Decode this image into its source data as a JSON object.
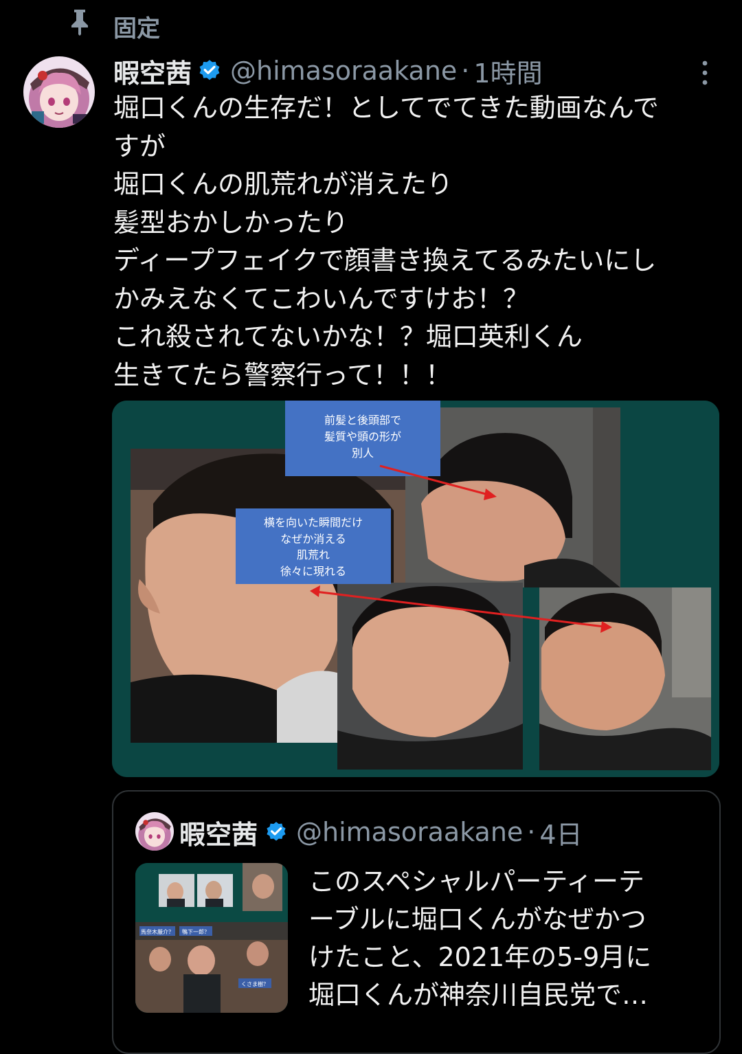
{
  "pinned": {
    "label": "固定",
    "icon": "pin-icon"
  },
  "post": {
    "author_name": "暇空茜",
    "handle": "@himasoraakane",
    "separator": "·",
    "time": "1時間",
    "verified_icon": "verified-badge-icon",
    "text_lines": [
      "堀口くんの生存だ！としてでてきた動画なんで",
      "すが",
      "堀口くんの肌荒れが消えたり",
      "髪型おかしかったり",
      "ディープフェイクで顔書き換えてるみたいにし",
      "かみえなくてこわいんですけお！？",
      "これ殺されてないかな！？堀口英利くん",
      "生きてたら警察行って！！！"
    ],
    "media": {
      "callout1_lines": [
        "前髪と後頭部で",
        "髪質や頭の形が",
        "別人"
      ],
      "callout2_lines": [
        "横を向いた瞬間だけ",
        "なぜか消える",
        "肌荒れ",
        "徐々に現れる"
      ]
    }
  },
  "quote": {
    "author_name": "暇空茜",
    "handle": "@himasoraakane",
    "separator": "·",
    "time": "4日",
    "text_lines": [
      "このスペシャルパーティーテ",
      "ーブルに堀口くんがなぜかつ",
      "けたこと、2021年の5-9月に",
      "堀口くんが神奈川自民党で…"
    ],
    "thumb_labels": [
      "馬奈木厳介？",
      "鴨下一郎？",
      "くさま樹？"
    ]
  },
  "colors": {
    "background": "#000000",
    "text": "#e7e9ea",
    "secondary_text": "#8b98a5",
    "verified": "#1d9bf0",
    "media_bg": "#0b4643",
    "callout": "#4472c4",
    "arrow": "#e02020"
  }
}
